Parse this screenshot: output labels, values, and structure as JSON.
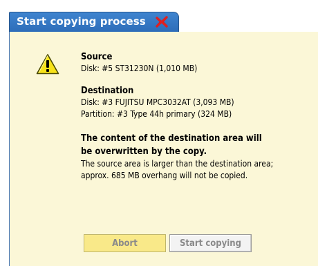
{
  "window": {
    "tab_title": "Start copying process",
    "close_icon": "close-x-icon",
    "accent_color": "#2c6cb8",
    "panel_color": "#fbf7d7"
  },
  "dialog": {
    "icon": "warning-icon",
    "source": {
      "heading": "Source",
      "line": "Disk: #5 ST31230N (1,010 MB)"
    },
    "destination": {
      "heading": "Destination",
      "disk_line": "Disk: #3 FUJITSU MPC3032AT (3,093 MB)",
      "partition_line": "Partition: #3 Type 44h primary (324 MB)"
    },
    "warning": {
      "bold_line_1": "The content of the destination area will",
      "bold_line_2": "be overwritten by the copy.",
      "info_line_1": "The source area is larger than the destination area;",
      "info_line_2": "approx. 685 MB overhang will not be copied."
    }
  },
  "buttons": {
    "abort_label": "Abort",
    "start_label": "Start copying"
  }
}
